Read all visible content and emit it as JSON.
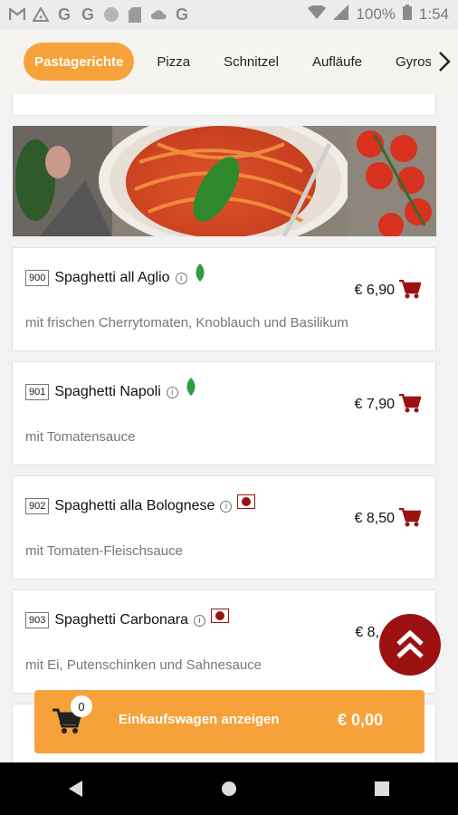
{
  "status_bar": {
    "battery": "100%",
    "time": "1:54",
    "g_glyph": "G"
  },
  "tabs": [
    {
      "label": "Pastagerichte",
      "active": true
    },
    {
      "label": "Pizza",
      "active": false
    },
    {
      "label": "Schnitzel",
      "active": false
    },
    {
      "label": "Aufläufe",
      "active": false
    },
    {
      "label": "Gyros",
      "active": false
    }
  ],
  "items": [
    {
      "number": "900",
      "name": "Spaghetti all Aglio",
      "badge": "leaf-icon",
      "price": "€ 6,90",
      "desc": "mit frischen Cherrytomaten, Knoblauch und Basilikum"
    },
    {
      "number": "901",
      "name": "Spaghetti Napoli",
      "badge": "leaf-icon",
      "price": "€ 7,90",
      "desc": "mit Tomatensauce"
    },
    {
      "number": "902",
      "name": "Spaghetti alla Bolognese",
      "badge": "meat-icon",
      "price": "€ 8,50",
      "desc": "mit Tomaten-Fleischsauce"
    },
    {
      "number": "903",
      "name": "Spaghetti Carbonara",
      "badge": "meat-icon",
      "price": "€ 8,",
      "desc": "mit Ei, Putenschinken und Sahnesauce"
    }
  ],
  "cart": {
    "count": "0",
    "label": "Einkaufswagen anzeigen",
    "total": "€ 0,00"
  },
  "colors": {
    "accent": "#f7a13a",
    "brand_red": "#9c1212",
    "veggie_green": "#2e9e3e"
  }
}
